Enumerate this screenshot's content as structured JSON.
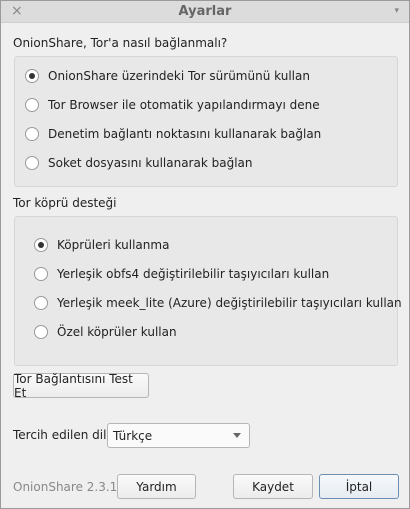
{
  "window": {
    "title": "Ayarlar",
    "close_icon": "×",
    "menu_icon": "▾"
  },
  "connection": {
    "label": "OnionShare, Tor'a nasıl bağlanmalı?",
    "options": [
      {
        "label": "OnionShare üzerindeki Tor sürümünü kullan",
        "selected": true
      },
      {
        "label": "Tor Browser ile otomatik yapılandırmayı dene",
        "selected": false
      },
      {
        "label": "Denetim bağlantı noktasını kullanarak bağlan",
        "selected": false
      },
      {
        "label": "Soket dosyasını kullanarak bağlan",
        "selected": false
      }
    ]
  },
  "bridges": {
    "label": "Tor köprü desteği",
    "options": [
      {
        "label": "Köprüleri kullanma",
        "selected": true
      },
      {
        "label": "Yerleşik obfs4 değiştirilebilir taşıyıcıları kullan",
        "selected": false
      },
      {
        "label": "Yerleşik meek_lite (Azure) değiştirilebilir taşıyıcıları kullan",
        "selected": false
      },
      {
        "label": "Özel köprüler kullan",
        "selected": false
      }
    ]
  },
  "test_button": "Tor Bağlantısını Test Et",
  "language": {
    "label": "Tercih edilen dil",
    "value": "Türkçe"
  },
  "footer": {
    "version": "OnionShare 2.3.1",
    "help": "Yardım",
    "save": "Kaydet",
    "cancel": "İptal"
  }
}
